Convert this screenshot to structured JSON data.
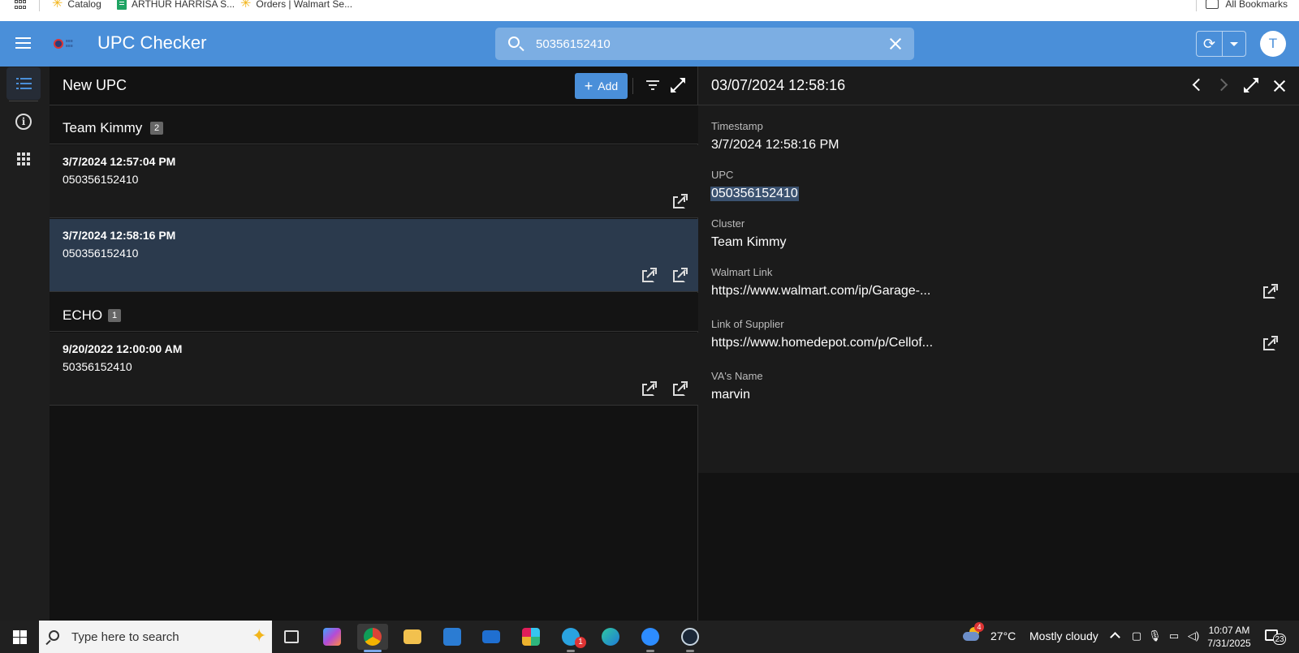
{
  "bookmarks": {
    "items": [
      {
        "label": "Catalog"
      },
      {
        "label": "ARTHUR HARRISA S..."
      },
      {
        "label": "Orders | Walmart Se..."
      }
    ],
    "all_bookmarks": "All Bookmarks"
  },
  "header": {
    "app_title": "UPC Checker",
    "search_value": "50356152410",
    "avatar_initial": "T",
    "sync_symbol": "⟳",
    "colors": {
      "header_bg": "#4a8fd9",
      "accent": "#4a8fd9"
    }
  },
  "list": {
    "title": "New UPC",
    "add_label": "Add",
    "add_symbol": "+",
    "groups": [
      {
        "name": "Team Kimmy",
        "count": "2",
        "rows": [
          {
            "date": "3/7/2024 12:57:04 PM",
            "upc": "050356152410"
          },
          {
            "date": "3/7/2024 12:58:16 PM",
            "upc": "050356152410"
          }
        ]
      },
      {
        "name": "ECHO",
        "count": "1",
        "rows": [
          {
            "date": "9/20/2022 12:00:00 AM",
            "upc": "50356152410"
          }
        ]
      }
    ]
  },
  "detail": {
    "title": "03/07/2024 12:58:16",
    "fields": {
      "timestamp": {
        "label": "Timestamp",
        "value": "3/7/2024 12:58:16 PM"
      },
      "upc": {
        "label": "UPC",
        "value": "050356152410"
      },
      "cluster": {
        "label": "Cluster",
        "value": "Team Kimmy"
      },
      "walmart_link": {
        "label": "Walmart Link",
        "value": "https://www.walmart.com/ip/Garage-..."
      },
      "supplier_link": {
        "label": "Link of Supplier",
        "value": "https://www.homedepot.com/p/Cellof..."
      },
      "va_name": {
        "label": "VA's Name",
        "value": "marvin"
      }
    }
  },
  "taskbar": {
    "search_placeholder": "Type here to search",
    "telegram_badge": "1",
    "weather": {
      "badge": "4",
      "temp": "27°C",
      "condition": "Mostly cloudy"
    },
    "clock": {
      "time": "10:07 AM",
      "date": "7/31/2025"
    },
    "notifications": "23"
  }
}
